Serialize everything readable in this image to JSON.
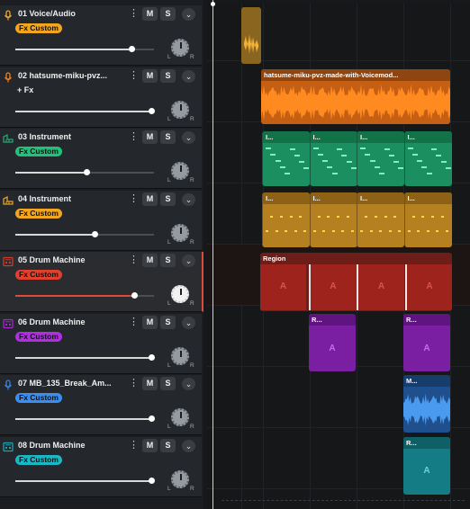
{
  "colors": {
    "voice": "#e8a735",
    "hatsune": "#f07f1c",
    "instrument3": "#23a772",
    "instrument4": "#e0a329",
    "drum5": "#d23b2c",
    "drum6": "#a626d0",
    "break7": "#3b82e0",
    "drum8": "#1aa3b0"
  },
  "tracks": [
    {
      "number": "01",
      "name": "Voice/Audio",
      "fx": "Fx Custom",
      "fx_color": "#f2a51e",
      "icon": "mic-icon",
      "icon_color": "#e8a735",
      "volume": 0.84,
      "selected": false
    },
    {
      "number": "02",
      "name": "hatsume-miku-pvz...",
      "fx": "+ Fx",
      "fx_color": "",
      "icon": "mic-icon",
      "icon_color": "#f07f1c",
      "volume": 0.98,
      "selected": false
    },
    {
      "number": "03",
      "name": "Instrument",
      "fx": "Fx Custom",
      "fx_color": "#23c07a",
      "icon": "piano-icon",
      "icon_color": "#23a772",
      "volume": 0.51,
      "selected": false
    },
    {
      "number": "04",
      "name": "Instrument",
      "fx": "Fx Custom",
      "fx_color": "#f2a51e",
      "icon": "piano-icon",
      "icon_color": "#e0a329",
      "volume": 0.57,
      "selected": false
    },
    {
      "number": "05",
      "name": "Drum Machine",
      "fx": "Fx Custom",
      "fx_color": "#e2402e",
      "icon": "drum-machine-icon",
      "icon_color": "#d23b2c",
      "volume": 0.86,
      "selected": true
    },
    {
      "number": "06",
      "name": "Drum Machine",
      "fx": "Fx Custom",
      "fx_color": "#b02fe0",
      "icon": "drum-machine-icon",
      "icon_color": "#a626d0",
      "volume": 0.98,
      "selected": false
    },
    {
      "number": "07",
      "name": "MB_135_Break_Am...",
      "fx": "Fx Custom",
      "fx_color": "#3b8ef0",
      "icon": "mic-icon",
      "icon_color": "#3b82e0",
      "volume": 0.98,
      "selected": false
    },
    {
      "number": "08",
      "name": "Drum Machine",
      "fx": "Fx Custom",
      "fx_color": "#1ab8c4",
      "icon": "drum-machine-icon",
      "icon_color": "#1aa3b0",
      "volume": 0.98,
      "selected": false
    }
  ],
  "buttons": {
    "mute": "M",
    "solo": "S",
    "kebab": "⋮",
    "chevron": "⌄",
    "left": "L",
    "right": "R"
  },
  "regions": {
    "hatsune_label": "hatsume-miku-pvz-made-with-Voicemod...",
    "instrument_label": "I...",
    "drum5_label": "Region",
    "drum_letter": "A",
    "short_r_label": "R...",
    "break_label": "M..."
  }
}
